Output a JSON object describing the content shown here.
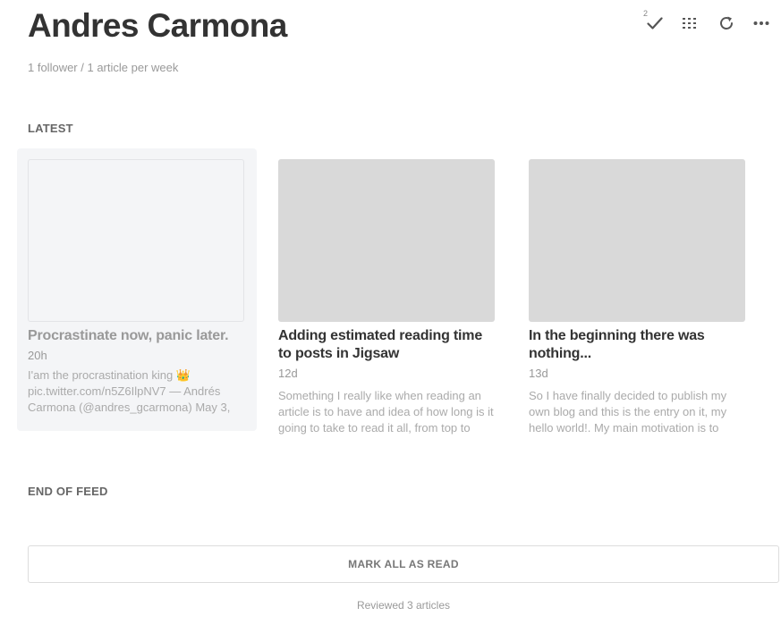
{
  "header": {
    "title": "Andres Carmona",
    "subtitle": "1 follower / 1 article per week"
  },
  "toolbar": {
    "mark_read": {
      "icon": "checkmark-icon",
      "badge": "2"
    },
    "layout": {
      "icon": "list-grid-icon"
    },
    "refresh": {
      "icon": "refresh-icon"
    },
    "more": {
      "icon": "more-horizontal-icon"
    }
  },
  "sections": {
    "latest_label": "LATEST",
    "end_label": "END OF FEED"
  },
  "articles": [
    {
      "title": "Procrastinate now, panic later.",
      "age": "20h",
      "snippet": "I'am the procrastination king 👑 pic.twitter.com/n5Z6IlpNV7 — Andrés Carmona (@andres_gcarmona) May 3,",
      "read": true
    },
    {
      "title": "Adding estimated reading time to posts in Jigsaw",
      "age": "12d",
      "snippet": "Something I really like when reading an article is to have and idea of how long is it going to take to read it all, from top to",
      "read": false
    },
    {
      "title": "In the beginning there was nothing...",
      "age": "13d",
      "snippet": "So I have finally decided to publish my own blog and this is the entry on it, my hello world!. My main motivation is to",
      "read": false
    }
  ],
  "footer": {
    "mark_all_label": "MARK ALL AS READ",
    "reviewed_text": "Reviewed 3 articles"
  },
  "colors": {
    "text": "#333333",
    "muted": "#999999",
    "thumbnail": "#d9d9d9",
    "read_card_bg": "#f4f5f7"
  }
}
